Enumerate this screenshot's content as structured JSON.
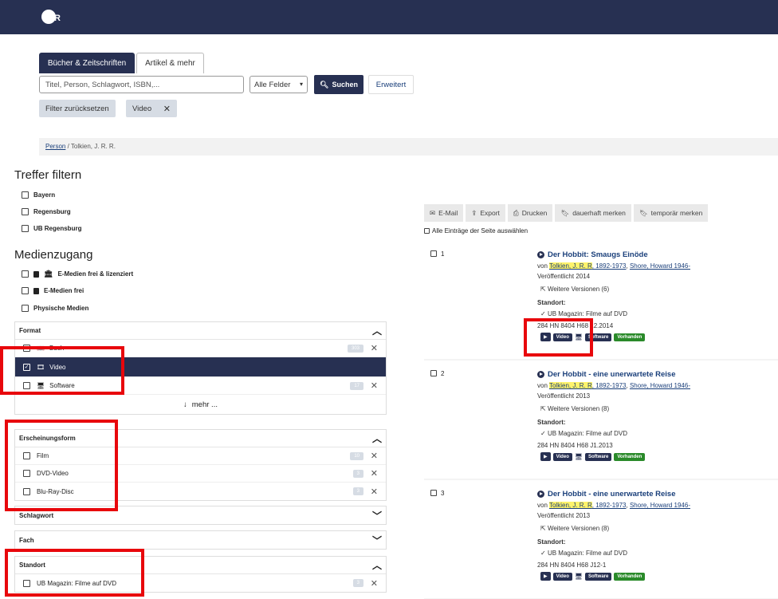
{
  "header": {
    "logo_text": "R"
  },
  "tabs": [
    {
      "label": "Bücher & Zeitschriften"
    },
    {
      "label": "Artikel & mehr"
    }
  ],
  "search": {
    "placeholder": "Titel, Person, Schlagwort, ISBN,...",
    "field_select": "Alle Felder",
    "search_label": "Suchen",
    "advanced_label": "Erweitert"
  },
  "filters": {
    "reset_label": "Filter zurücksetzen",
    "active_chip": "Video"
  },
  "breadcrumb": {
    "parent": "Person",
    "separator": "/",
    "current": "Tolkien, J. R. R."
  },
  "sidebar": {
    "heading": "Treffer filtern",
    "locations": [
      "Bayern",
      "Regensburg",
      "UB Regensburg"
    ],
    "access_heading": "Medienzugang",
    "access": [
      "E-Medien frei & lizenziert",
      "E-Medien frei",
      "Physische Medien"
    ],
    "format": {
      "title": "Format",
      "items": [
        {
          "label": "Buch",
          "count": "303"
        },
        {
          "label": "Video",
          "count": ""
        },
        {
          "label": "Software",
          "count": "17"
        }
      ],
      "more_label": "mehr ..."
    },
    "erscheinungsform": {
      "title": "Erscheinungsform",
      "items": [
        {
          "label": "Film",
          "count": "10"
        },
        {
          "label": "DVD-Video",
          "count": "3"
        },
        {
          "label": "Blu-Ray-Disc",
          "count": "3"
        }
      ]
    },
    "schlagwort": {
      "title": "Schlagwort"
    },
    "fach": {
      "title": "Fach"
    },
    "standort": {
      "title": "Standort",
      "items": [
        {
          "label": "UB Magazin: Filme auf DVD",
          "count": "3"
        }
      ]
    }
  },
  "toolbar": {
    "email": "E-Mail",
    "export": "Export",
    "print": "Drucken",
    "save_perm": "dauerhaft merken",
    "save_temp": "temporär merken",
    "select_all": "Alle Einträge der Seite auswählen"
  },
  "results": [
    {
      "num": "1",
      "title": "Der Hobbit: Smaugs Einöde",
      "by": "von",
      "author1": "Tolkien, J. R. R",
      "author1_dates": ", 1892-1973",
      "sep": ",",
      "author2": "Shore, Howard 1946-",
      "published": "Veröffentlicht 2014",
      "versions": "Weitere Versionen (6)",
      "location_label": "Standort:",
      "location": "UB Magazin: Filme auf DVD",
      "signature": "284 HN 8404 H68 12.2014",
      "badges": [
        "Video",
        "Software",
        "Vorhanden"
      ]
    },
    {
      "num": "2",
      "title": "Der Hobbit - eine unerwartete Reise",
      "by": "von",
      "author1": "Tolkien, J. R. R",
      "author1_dates": ", 1892-1973",
      "sep": ",",
      "author2": "Shore, Howard 1946-",
      "published": "Veröffentlicht 2013",
      "versions": "Weitere Versionen (8)",
      "location_label": "Standort:",
      "location": "UB Magazin: Filme auf DVD",
      "signature": "284 HN 8404 H68 J1.2013",
      "badges": [
        "Video",
        "Software",
        "Vorhanden"
      ]
    },
    {
      "num": "3",
      "title": "Der Hobbit - eine unerwartete Reise",
      "by": "von",
      "author1": "Tolkien, J. R. R",
      "author1_dates": ", 1892-1973",
      "sep": ",",
      "author2": "Shore, Howard 1946-",
      "published": "Veröffentlicht 2013",
      "versions": "Weitere Versionen (8)",
      "location_label": "Standort:",
      "location": "UB Magazin: Filme auf DVD",
      "signature": "284 HN 8404 H68 J12-1",
      "badges": [
        "Video",
        "Software",
        "Vorhanden"
      ]
    }
  ]
}
